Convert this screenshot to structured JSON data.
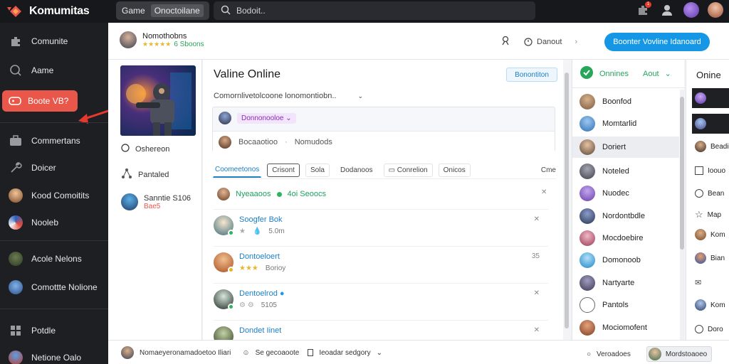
{
  "app": {
    "name": "Komumitas"
  },
  "topbar": {
    "tab_game": "Game",
    "tab_sub": "Onoctoilane",
    "search_placeholder": "Bodoit..",
    "notif_count": "1"
  },
  "sidebar": {
    "items": [
      {
        "label": "Comunite",
        "icon": "puzzle-icon"
      },
      {
        "label": "Aame",
        "icon": "search-icon"
      },
      {
        "label": "Boote VB?",
        "icon": "gamepad-icon"
      },
      {
        "label": "Commertans",
        "icon": "briefcase-icon"
      },
      {
        "label": "Doicer",
        "icon": "wrench-icon"
      },
      {
        "label": "Kood Comoitits",
        "icon": "avatar"
      },
      {
        "label": "Nooleb",
        "icon": "avatar"
      },
      {
        "label": "Acole Nelons",
        "icon": "avatar"
      },
      {
        "label": "Comottte Nolione",
        "icon": "avatar"
      },
      {
        "label": "Potdle",
        "icon": "grid-icon"
      },
      {
        "label": "Netione Oalo",
        "icon": "avatar"
      }
    ]
  },
  "header": {
    "username": "Nomothobns",
    "subtitle": "6 Sboons",
    "action_1": "",
    "action_2": "Danout",
    "primary_button": "Boonter Vovline Idanoard"
  },
  "profile": {
    "row1": "Oshereon",
    "row2": "Pantaled",
    "user_name": "Sanntie S106",
    "user_sub": "Bae5"
  },
  "main": {
    "title": "Valine Online",
    "badge": "Bonontiton",
    "subtitle": "Comornlivetolcoone lonomontiobn..",
    "composer_pill": "Donnonooloe",
    "composer_a": "Bocaaotioo",
    "composer_b": "Nomudods",
    "tabs": [
      "Coomeetonos",
      "Crisont",
      "Sola",
      "Dodanoos",
      "Conrelion",
      "Onicos"
    ],
    "tab_end": "Cme",
    "online_a": "Nyeaaoos",
    "online_b": "4oi Seoocs",
    "feed": [
      {
        "name": "Soogfer Bok",
        "meta": "5.0m",
        "x": "",
        "status": "#2db55d"
      },
      {
        "name": "Dontoeloert",
        "meta": "Borioy",
        "x": "35",
        "status": "#e6b31e"
      },
      {
        "name": "Dentoelrod",
        "meta": "5105",
        "x": "",
        "status": "#2db55d"
      },
      {
        "name": "Dondet Iinet",
        "meta": "",
        "x": "",
        "status": "#2db55d"
      }
    ]
  },
  "friends": {
    "head_a": "Onnines",
    "head_b": "Aout",
    "items": [
      {
        "label": "Boonfod",
        "color": "#7a5c43"
      },
      {
        "label": "Momtarlid",
        "color": "#2f6fb5"
      },
      {
        "label": "Doriert",
        "color": "#5a4636"
      },
      {
        "label": "Noteled",
        "color": "#3e3e48"
      },
      {
        "label": "Nuodec",
        "color": "#6a3fa8"
      },
      {
        "label": "Nordontbdle",
        "color": "#27344f"
      },
      {
        "label": "Mocdoebire",
        "color": "#9b3a55"
      },
      {
        "label": "Domonoob",
        "color": "#1e86c8"
      },
      {
        "label": "Nartyarte",
        "color": "#3c3850"
      },
      {
        "label": "Pantols",
        "color": "#ffffff"
      },
      {
        "label": "Mociomofent",
        "color": "#7a3d22"
      }
    ]
  },
  "online": {
    "title": "Onine",
    "items": [
      "",
      "",
      "Beadi",
      "Ioouo",
      "Bean",
      "Map",
      "Kom",
      "Bian",
      "",
      "Kom",
      "Doro"
    ]
  },
  "bottom": {
    "status": "Nomaeyeronamadoetoo Iliari",
    "item2": "Se gecoaoote",
    "item3": "Ieoadar sedgory",
    "right1": "Veroadoes",
    "right2": "Mordstoaoeo"
  },
  "colors": {
    "accent": "#e9564a",
    "blue": "#1597e5",
    "green": "#2db55d"
  }
}
